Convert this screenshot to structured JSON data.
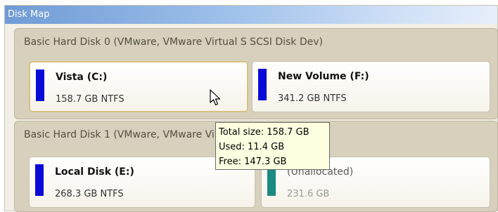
{
  "panel": {
    "title": "Disk Map"
  },
  "disks": [
    {
      "title": "Basic Hard Disk 0 (VMware, VMware Virtual S SCSI Disk Dev)",
      "volumes": [
        {
          "name": "Vista (C:)",
          "info": "158.7 GB NTFS",
          "color": "#0a0ad8"
        },
        {
          "name": "New Volume (F:)",
          "info": "341.2 GB NTFS",
          "color": "#0a0ad8"
        }
      ]
    },
    {
      "title": "Basic Hard Disk 1 (VMware, VMware Virtual S SCSI Disk Dev)",
      "volumes": [
        {
          "name": "Local Disk (E:)",
          "info": "268.3 GB NTFS",
          "color": "#0a0ad8"
        },
        {
          "name": "(Unallocated)",
          "info": "231.6 GB",
          "color": "#1a8a82"
        }
      ]
    }
  ],
  "tooltip": {
    "total": "Total size: 158.7 GB",
    "used": "Used: 11.4 GB",
    "free": "Free: 147.3 GB"
  }
}
